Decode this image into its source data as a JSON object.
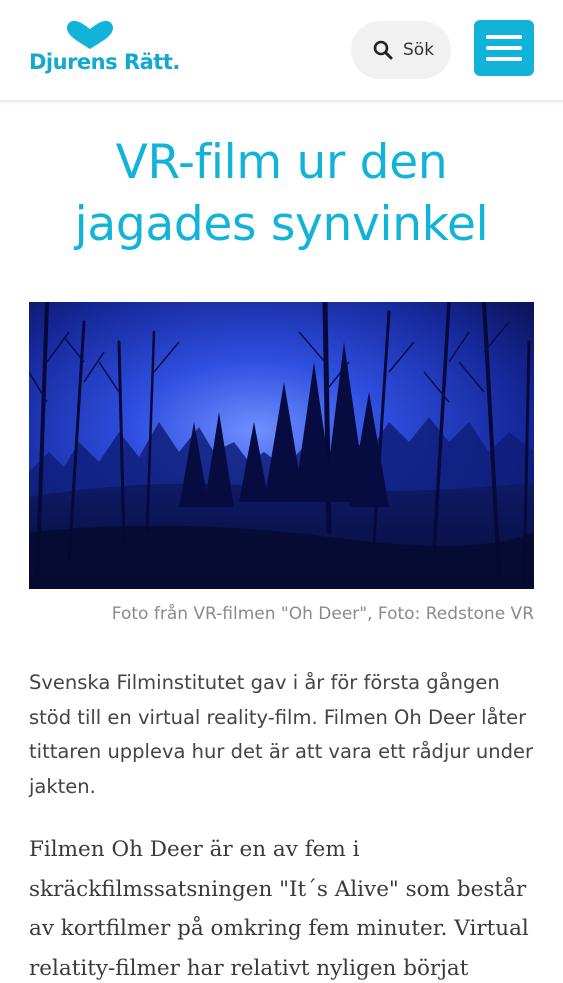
{
  "header": {
    "logo_text": "Djurens Rätt.",
    "search_label": "Sök",
    "brand_color": "#12b3d8"
  },
  "article": {
    "title": "VR-film ur den jagades synvinkel",
    "image_caption": "Foto från VR-filmen \"Oh Deer\", Foto: Redstone VR",
    "lead": "Svenska Filminstitutet gav i år för första gången stöd till en virtual reality-film. Filmen Oh Deer låter tittaren uppleva hur det är att vara ett rådjur under jakten.",
    "body": "Filmen Oh Deer är en av fem i skräckfilmssatsningen \"It´s Alive\" som består av kortfilmer på omkring fem minuter. Virtual relatity-filmer har relativt nyligen börjat"
  },
  "icons": {
    "search": "search-icon",
    "menu": "hamburger-menu-icon",
    "logo": "heart-logo-icon"
  }
}
